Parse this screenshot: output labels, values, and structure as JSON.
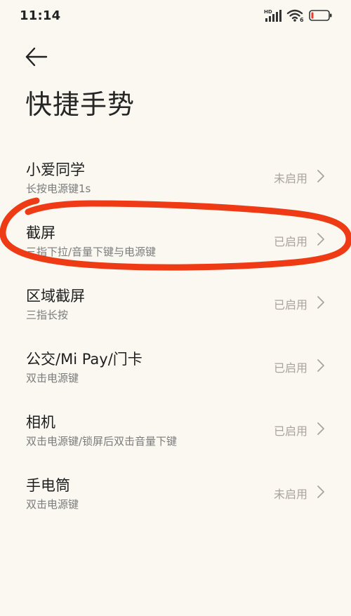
{
  "status_bar": {
    "time": "11:14",
    "network_label": "HD",
    "wifi_label": "6",
    "battery_color": "#e53b2a"
  },
  "header": {
    "back_icon": "arrow-left-icon",
    "title": "快捷手势"
  },
  "list": {
    "items": [
      {
        "title": "小爱同学",
        "subtitle": "长按电源键1s",
        "status": "未启用"
      },
      {
        "title": "截屏",
        "subtitle": "三指下拉/音量下键与电源键",
        "status": "已启用"
      },
      {
        "title": "区域截屏",
        "subtitle": "三指长按",
        "status": "已启用"
      },
      {
        "title": "公交/Mi Pay/门卡",
        "subtitle": "双击电源键",
        "status": "已启用"
      },
      {
        "title": "相机",
        "subtitle": "双击电源键/锁屏后双击音量下键",
        "status": "已启用"
      },
      {
        "title": "手电筒",
        "subtitle": "双击电源键",
        "status": "未启用"
      }
    ]
  },
  "annotation": {
    "color": "#ee3b16"
  },
  "colors": {
    "background": "#fbf8f2",
    "status_text": "#a8a49c"
  }
}
